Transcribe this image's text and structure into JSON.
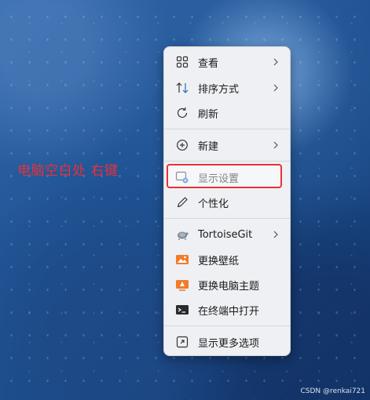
{
  "annotation": {
    "text": "电脑空白处 右键",
    "color": "#e8303a"
  },
  "menu": {
    "items": [
      {
        "label": "查看",
        "icon": "grid-view-icon",
        "submenu": true
      },
      {
        "label": "排序方式",
        "icon": "sort-icon",
        "submenu": true
      },
      {
        "label": "刷新",
        "icon": "refresh-icon",
        "submenu": false
      },
      {
        "label": "新建",
        "icon": "new-plus-icon",
        "submenu": true
      },
      {
        "label": "显示设置",
        "icon": "display-settings-icon",
        "submenu": false,
        "highlighted": true
      },
      {
        "label": "个性化",
        "icon": "pen-icon",
        "submenu": false
      },
      {
        "label": "TortoiseGit",
        "icon": "tortoisegit-icon",
        "submenu": true
      },
      {
        "label": "更换壁纸",
        "icon": "wallpaper-icon",
        "submenu": false
      },
      {
        "label": "更换电脑主题",
        "icon": "theme-icon",
        "submenu": false
      },
      {
        "label": "在终端中打开",
        "icon": "terminal-icon",
        "submenu": false
      },
      {
        "label": "显示更多选项",
        "icon": "more-options-icon",
        "submenu": false
      }
    ]
  },
  "watermark": "CSDN @renkai721",
  "colors": {
    "accent_red": "#e8303a",
    "menu_bg": "#eef0f3",
    "orange_icon": "#f07c2a"
  }
}
